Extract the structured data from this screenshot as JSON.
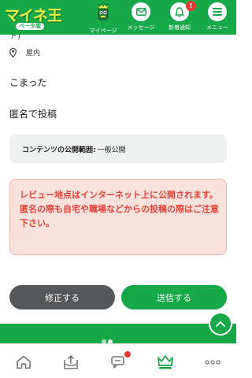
{
  "header": {
    "logo_title": "マイネ王",
    "logo_sub": "ベータ版",
    "nav": [
      {
        "label": "マイページ",
        "icon": "mascot-icon"
      },
      {
        "label": "メッセージ",
        "icon": "mail-icon"
      },
      {
        "label": "新着通知",
        "icon": "bell-icon",
        "badge": "!"
      },
      {
        "label": "メニュー",
        "icon": "hamburger-icon"
      }
    ]
  },
  "content": {
    "partial_text": "ト)",
    "location": "屋内",
    "line1": "こまった",
    "line2": "匿名で投稿",
    "scope_label": "コンテンツの公開範囲:",
    "scope_value": "一般公開",
    "warning_line1": "レビュー地点はインターネット上に公開されます。",
    "warning_line2": "匿名の際も自宅や職場などからの投稿の際はご注意下さい。"
  },
  "buttons": {
    "edit": "修正する",
    "send": "送信する"
  },
  "colors": {
    "brand_green": "#17a84a",
    "warning_text": "#e0453a",
    "warning_bg": "#fbe1dc",
    "edit_button": "#555759",
    "badge_red": "#e53935"
  },
  "tabbar": {
    "items": [
      "home-icon",
      "post-icon",
      "chat-icon",
      "crown-icon",
      "more-icon"
    ]
  }
}
